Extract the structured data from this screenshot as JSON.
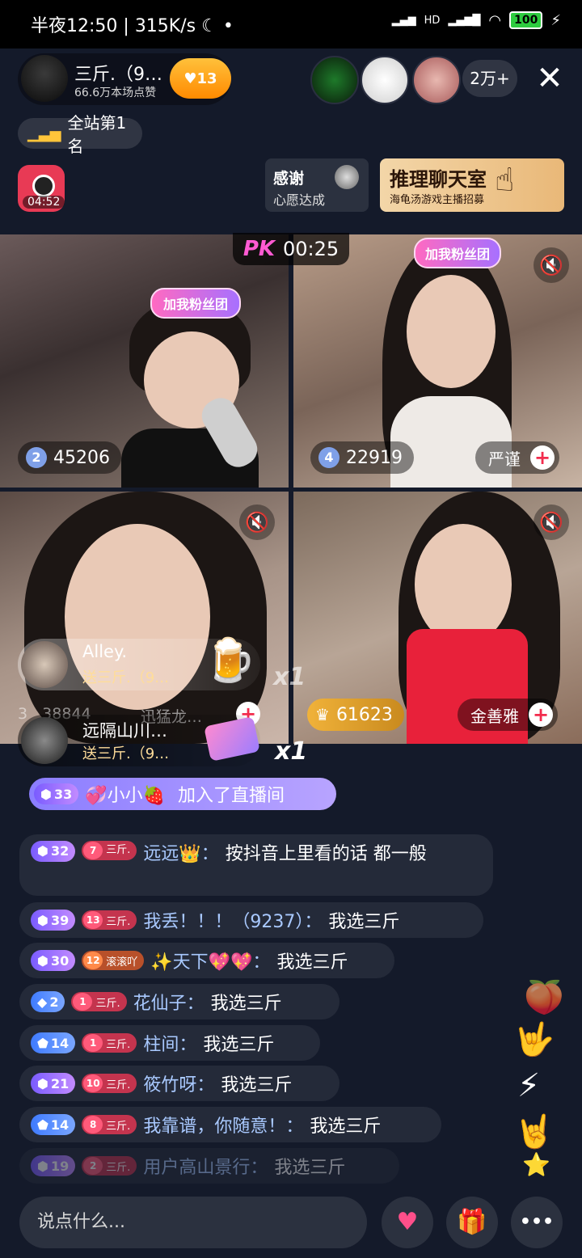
{
  "status_bar": {
    "time": "半夜12:50",
    "net_speed": "315K/s",
    "moon": "☾",
    "dot": "•",
    "hd": "HD",
    "battery": "100"
  },
  "header": {
    "host_name": "三斤.（9…",
    "host_likes": "66.6万本场点赞",
    "fav_level": "13",
    "viewer_count": "2万+",
    "close_icon": "close-icon",
    "rank_text": "全站第1名"
  },
  "widgets": {
    "clock_time": "04:52",
    "thanks_title": "感谢",
    "thanks_sub": "心愿达成",
    "ad_title": "推理聊天室",
    "ad_sub": "海龟汤游戏主播招募"
  },
  "pk": {
    "label": "PK",
    "timer": "00:25"
  },
  "tiles": [
    {
      "rank": "2",
      "score": "45206",
      "fan_tag": "加我粉丝团"
    },
    {
      "rank": "4",
      "score": "22919",
      "name": "严谨",
      "fan_tag": "加我粉丝团"
    },
    {
      "rank": "3",
      "score": "38844",
      "name": "迅猛龙…"
    },
    {
      "rank": "1",
      "score": "61623",
      "name": "金善雅"
    }
  ],
  "gifts": [
    {
      "name": "Alley.",
      "to": "送三斤.（9…",
      "count": "x1"
    },
    {
      "name": "远隔山川…",
      "to": "送三斤.（9…",
      "count": "x1"
    }
  ],
  "join": {
    "level": "33",
    "user": "💞小小🍓",
    "text": "加入了直播间"
  },
  "chat": [
    {
      "level": "32",
      "fan_level": "7",
      "fan_name": "三斤.",
      "user": "远远👑：",
      "text": "按抖音上里看的话 都一般"
    },
    {
      "level": "39",
      "fan_level": "13",
      "fan_name": "三斤.",
      "user": "我丢！！！（9237）：",
      "text": "我选三斤"
    },
    {
      "level": "30",
      "fan_level": "12",
      "fan_name": "滚滚吖",
      "user": "✨天下💖💖：",
      "text": "我选三斤"
    },
    {
      "level": "2",
      "fan_level": "1",
      "fan_name": "三斤.",
      "user": "花仙子：",
      "text": "我选三斤"
    },
    {
      "level": "14",
      "fan_level": "1",
      "fan_name": "三斤.",
      "user": "柱间：",
      "text": "我选三斤"
    },
    {
      "level": "21",
      "fan_level": "10",
      "fan_name": "三斤.",
      "user": "筱竹呀：",
      "text": "我选三斤"
    },
    {
      "level": "14",
      "fan_level": "8",
      "fan_name": "三斤.",
      "user": "我靠谱，你随意！：",
      "text": "我选三斤"
    },
    {
      "level": "19",
      "fan_level": "2",
      "fan_name": "三斤.",
      "user": "用户高山景行：",
      "text": "我选三斤"
    }
  ],
  "bottom": {
    "input_placeholder": "说点什么...",
    "heart_icon": "heart-icon",
    "gift_icon": "gift-icon",
    "more_icon": "more-icon",
    "more_glyph": "•••"
  },
  "colors": {
    "accent": "#f22c4d",
    "level_purple": "#7a5cff",
    "level_blue": "#3f7bff",
    "background": "#141a2a"
  }
}
